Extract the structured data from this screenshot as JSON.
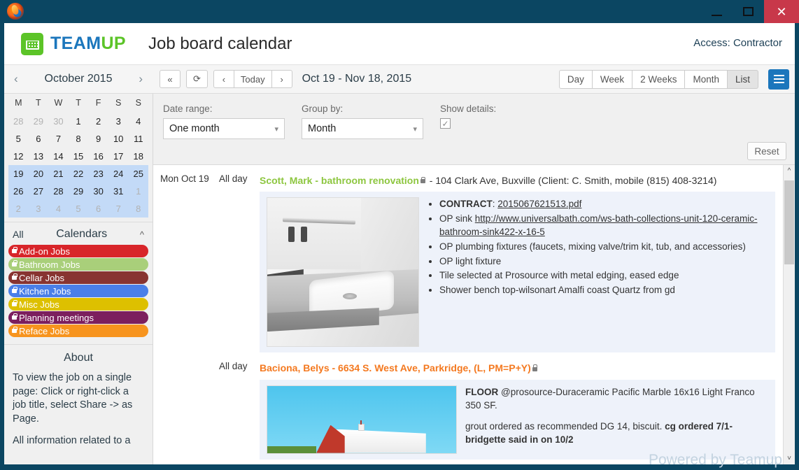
{
  "window": {
    "browser_icon": "firefox-icon",
    "minimize": "—",
    "maximize": "▢",
    "close": "✕"
  },
  "header": {
    "logo_text_1": "TEAM",
    "logo_text_2": "UP",
    "title": "Job board calendar",
    "access": "Access: Contractor"
  },
  "navbar": {
    "prev_month": "‹",
    "month_label": "October 2015",
    "next_month": "›",
    "first_btn": "«",
    "refresh_btn": "⟳",
    "prev_btn": "‹",
    "today_btn": "Today",
    "next_btn": "›",
    "range_label": "Oct 19 - Nov 18, 2015",
    "views": [
      "Day",
      "Week",
      "2 Weeks",
      "Month",
      "List"
    ],
    "active_view": "List",
    "menu_icon": "hamburger-icon"
  },
  "minical": {
    "weekdays": [
      "M",
      "T",
      "W",
      "T",
      "F",
      "S",
      "S"
    ],
    "weeks": [
      {
        "selected": false,
        "days": [
          {
            "n": "28",
            "dim": true
          },
          {
            "n": "29",
            "dim": true
          },
          {
            "n": "30",
            "dim": true
          },
          {
            "n": "1",
            "dim": false
          },
          {
            "n": "2",
            "dim": false
          },
          {
            "n": "3",
            "dim": false
          },
          {
            "n": "4",
            "dim": false
          }
        ]
      },
      {
        "selected": false,
        "days": [
          {
            "n": "5",
            "dim": false
          },
          {
            "n": "6",
            "dim": false
          },
          {
            "n": "7",
            "dim": false
          },
          {
            "n": "8",
            "dim": false
          },
          {
            "n": "9",
            "dim": false
          },
          {
            "n": "10",
            "dim": false
          },
          {
            "n": "11",
            "dim": false
          }
        ]
      },
      {
        "selected": false,
        "days": [
          {
            "n": "12",
            "dim": false
          },
          {
            "n": "13",
            "dim": false
          },
          {
            "n": "14",
            "dim": false
          },
          {
            "n": "15",
            "dim": false
          },
          {
            "n": "16",
            "dim": false
          },
          {
            "n": "17",
            "dim": false
          },
          {
            "n": "18",
            "dim": false
          }
        ]
      },
      {
        "selected": true,
        "days": [
          {
            "n": "19",
            "dim": false
          },
          {
            "n": "20",
            "dim": false
          },
          {
            "n": "21",
            "dim": false
          },
          {
            "n": "22",
            "dim": false
          },
          {
            "n": "23",
            "dim": false
          },
          {
            "n": "24",
            "dim": false
          },
          {
            "n": "25",
            "dim": false
          }
        ]
      },
      {
        "selected": true,
        "days": [
          {
            "n": "26",
            "dim": false
          },
          {
            "n": "27",
            "dim": false
          },
          {
            "n": "28",
            "dim": false
          },
          {
            "n": "29",
            "dim": false
          },
          {
            "n": "30",
            "dim": false
          },
          {
            "n": "31",
            "dim": false
          },
          {
            "n": "1",
            "dim": true
          }
        ]
      },
      {
        "selected": true,
        "days": [
          {
            "n": "2",
            "dim": true
          },
          {
            "n": "3",
            "dim": true
          },
          {
            "n": "4",
            "dim": true
          },
          {
            "n": "5",
            "dim": true
          },
          {
            "n": "6",
            "dim": true
          },
          {
            "n": "7",
            "dim": true
          },
          {
            "n": "8",
            "dim": true
          }
        ]
      }
    ]
  },
  "calendars": {
    "all_label": "All",
    "title": "Calendars",
    "collapse_icon": "chevron-up-icon",
    "items": [
      {
        "label": "Add-on Jobs",
        "color": "#d8252a"
      },
      {
        "label": "Bathroom Jobs",
        "color": "#a9cf7a"
      },
      {
        "label": "Cellar Jobs",
        "color": "#883431"
      },
      {
        "label": "Kitchen Jobs",
        "color": "#4a7fe8"
      },
      {
        "label": "Misc Jobs",
        "color": "#ddc000"
      },
      {
        "label": "Planning meetings",
        "color": "#7c1f5e"
      },
      {
        "label": "Reface Jobs",
        "color": "#f7941e"
      }
    ]
  },
  "about": {
    "title": "About",
    "paragraph1": "To view the job on a single page: Click or right-click a job title, select Share -> as Page.",
    "paragraph2": "All information related to a"
  },
  "filters": {
    "date_range_label": "Date range:",
    "date_range_value": "One month",
    "group_by_label": "Group by:",
    "group_by_value": "Month",
    "show_details_label": "Show details:",
    "show_details_checked": "✓",
    "reset_label": "Reset",
    "chevron_icon": "chevron-down-icon"
  },
  "events": [
    {
      "date": "Mon Oct 19",
      "time": "All day",
      "title": "Scott, Mark - bathroom renovation",
      "title_color": "green",
      "lock_icon": "lock-icon",
      "subtitle": " - 104 Clark Ave, Buxville (Client: C. Smith, mobile (815) 408-3214)",
      "image": "bathroom-sink-photo",
      "bullets": [
        {
          "prefix": "CONTRACT: ",
          "link": "2015067621513.pdf",
          "text": ""
        },
        {
          "prefix": "OP sink   ",
          "link": "http://www.universalbath.com/ws-bath-collections-unit-120-ceramic-bathroom-sink422-x-16-5",
          "text": ""
        },
        {
          "prefix": "",
          "link": "",
          "text": "OP plumbing fixtures (faucets, mixing valve/trim kit, tub, and accessories)"
        },
        {
          "prefix": "",
          "link": "",
          "text": "OP light fixture"
        },
        {
          "prefix": "",
          "link": "",
          "text": "Tile selected at Prosource with metal edging, eased edge"
        },
        {
          "prefix": "",
          "link": "",
          "text": "Shower bench top-wilsonart Amalfi coast Quartz from gd"
        }
      ]
    },
    {
      "date": "",
      "time": "All day",
      "title": "Baciona, Belys - 6634 S. West Ave, Parkridge, (L, PM=P+Y)",
      "title_color": "orange",
      "lock_icon": "lock-icon",
      "subtitle": "",
      "image": "red-barn-photo",
      "paragraph1_bold": "FLOOR ",
      "paragraph1": "@prosource-Duraceramic Pacific Marble 16x16 Light Franco 350 SF.",
      "paragraph2": "grout ordered as recommended DG 14, biscuit. ",
      "paragraph2_bold": "cg ordered 7/1-bridgette said in on 10/2"
    }
  ],
  "scrollbar": {
    "up_icon": "chevron-up-icon",
    "down_icon": "chevron-down-icon"
  },
  "watermark": "Powered by Teamup"
}
